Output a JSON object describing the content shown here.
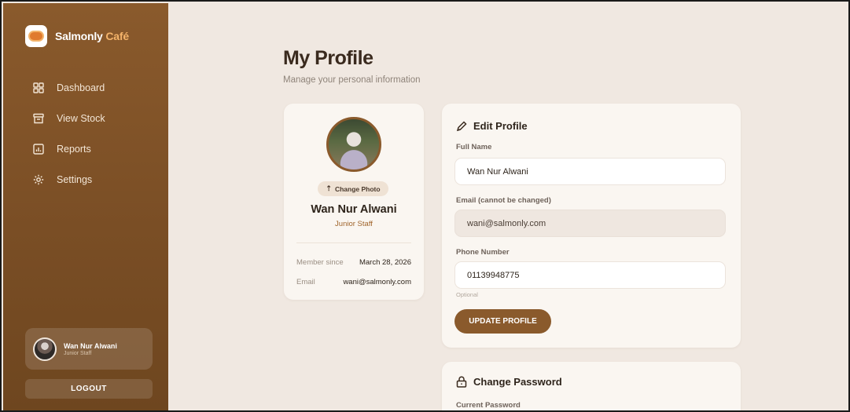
{
  "brand": {
    "name_main": "Salmonly",
    "name_accent": "Café"
  },
  "sidebar": {
    "items": [
      {
        "label": "Dashboard",
        "icon": "dashboard-icon"
      },
      {
        "label": "View Stock",
        "icon": "archive-box-icon"
      },
      {
        "label": "Reports",
        "icon": "bar-chart-icon"
      },
      {
        "label": "Settings",
        "icon": "gear-icon"
      }
    ],
    "user": {
      "name": "Wan Nur Alwani",
      "role": "Junior Staff"
    },
    "logout_label": "LOGOUT"
  },
  "page": {
    "title": "My Profile",
    "subtitle": "Manage your personal information"
  },
  "profile_card": {
    "change_photo_icon": "⇡",
    "change_photo_label": "Change Photo",
    "name": "Wan Nur Alwani",
    "role": "Junior Staff",
    "member_since_label": "Member since",
    "member_since_value": "March 28, 2026",
    "email_label": "Email",
    "email_value": "wani@salmonly.com"
  },
  "edit_profile": {
    "title": "Edit Profile",
    "full_name_label": "Full Name",
    "full_name_value": "Wan Nur Alwani",
    "email_label": "Email (cannot be changed)",
    "email_value": "wani@salmonly.com",
    "phone_label": "Phone Number",
    "phone_value": "01139948775",
    "phone_hint": "Optional",
    "update_label": "UPDATE PROFILE"
  },
  "change_password": {
    "title": "Change Password",
    "current_label": "Current Password"
  },
  "colors": {
    "accent": "#8a5a2c",
    "background": "#f0e8e1",
    "card": "#faf6f1"
  }
}
